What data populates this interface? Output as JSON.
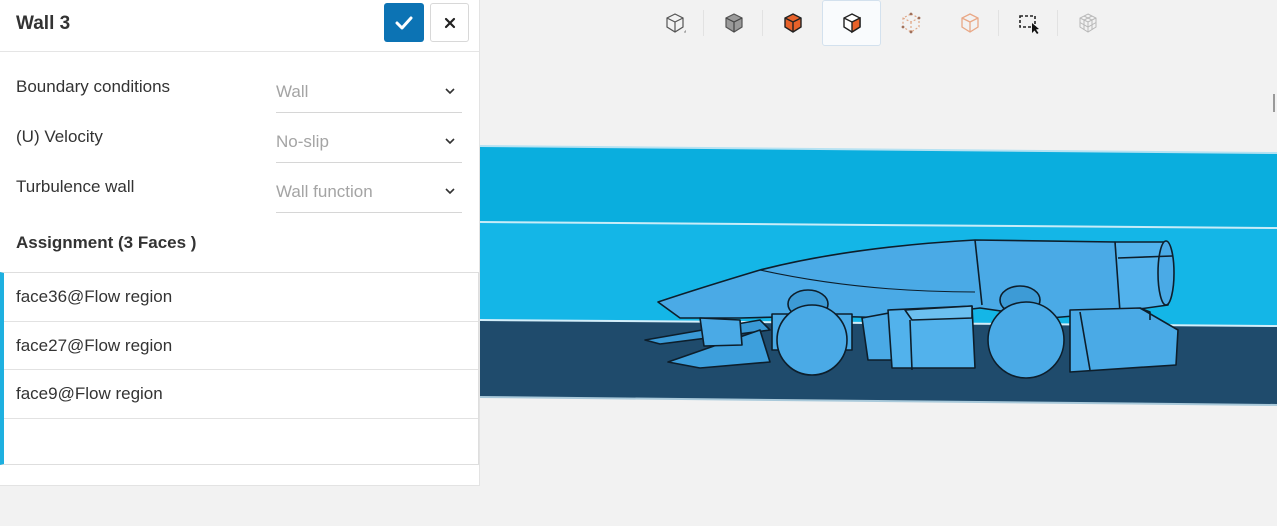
{
  "panel": {
    "title": "Wall 3",
    "confirm_icon": "checkmark-icon",
    "close_icon": "close-icon",
    "fields": [
      {
        "label": "Boundary conditions",
        "value": "Wall"
      },
      {
        "label": "(U) Velocity",
        "value": "No-slip"
      },
      {
        "label": "Turbulence wall",
        "value": "Wall function"
      }
    ],
    "assignment_title": "Assignment (3 Faces )",
    "assignment_items": [
      "face36@Flow region",
      "face27@Flow region",
      "face9@Flow region",
      ""
    ]
  },
  "toolbar": {
    "buttons": [
      {
        "icon": "wireframe-cube-icon"
      },
      {
        "icon": "solid-cube-icon"
      },
      {
        "icon": "select-volume-icon"
      },
      {
        "icon": "select-face-icon",
        "active": true
      },
      {
        "icon": "select-edge-icon"
      },
      {
        "icon": "select-point-icon"
      },
      {
        "icon": "box-select-icon"
      },
      {
        "icon": "mesh-view-icon"
      }
    ]
  },
  "colors": {
    "accent": "#0c73b4",
    "assignment_bar": "#1eb0e0",
    "flow_top": "#0aaede",
    "flow_mid": "#11b7e8",
    "flow_bottom": "#1e4a6b",
    "car_body": "#4aaae6"
  }
}
